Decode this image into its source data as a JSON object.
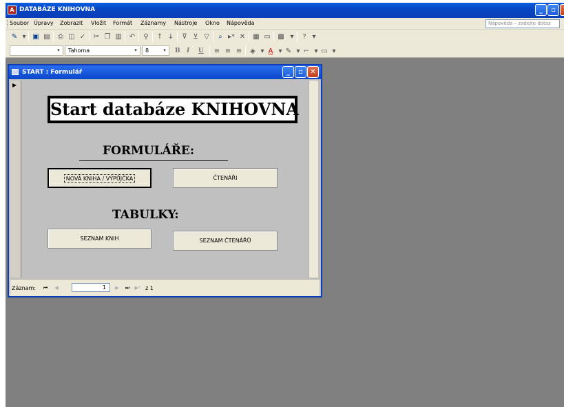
{
  "app": {
    "title": "DATABÁZE KNIHOVNA",
    "window_controls": {
      "minimize": "_",
      "restore": "▫",
      "close": "✕"
    }
  },
  "menu": {
    "items": [
      "Soubor",
      "Úpravy",
      "Zobrazit",
      "Vložit",
      "Formát",
      "Záznamy",
      "Nástroje",
      "Okno",
      "Nápověda"
    ],
    "help_placeholder": "Nápověda – zadejte dotaz"
  },
  "toolbar": {
    "font_name": "Tahoma",
    "font_size": "8",
    "bold": "B",
    "italic": "I",
    "underline": "U"
  },
  "form_window": {
    "title": "START : Formulář",
    "heading": "Start databáze KNIHOVNA",
    "forms_section": "FORMULÁŘE:",
    "tables_section": "TABULKY:",
    "buttons": {
      "new_book": "NOVÁ KNIHA / VÝPŮJČKA",
      "readers": "ČTENÁŘI",
      "book_list": "SEZNAM KNIH",
      "reader_list": "SEZNAM ČTENÁŘŮ"
    },
    "navigation": {
      "label": "Záznam:",
      "current": "1",
      "count": "z 1"
    }
  },
  "icons": {
    "record_pointer": "▶",
    "nav_first": "⏮",
    "nav_prev": "◀",
    "nav_next": "▶",
    "nav_last": "⏭",
    "nav_new": "▶*"
  }
}
